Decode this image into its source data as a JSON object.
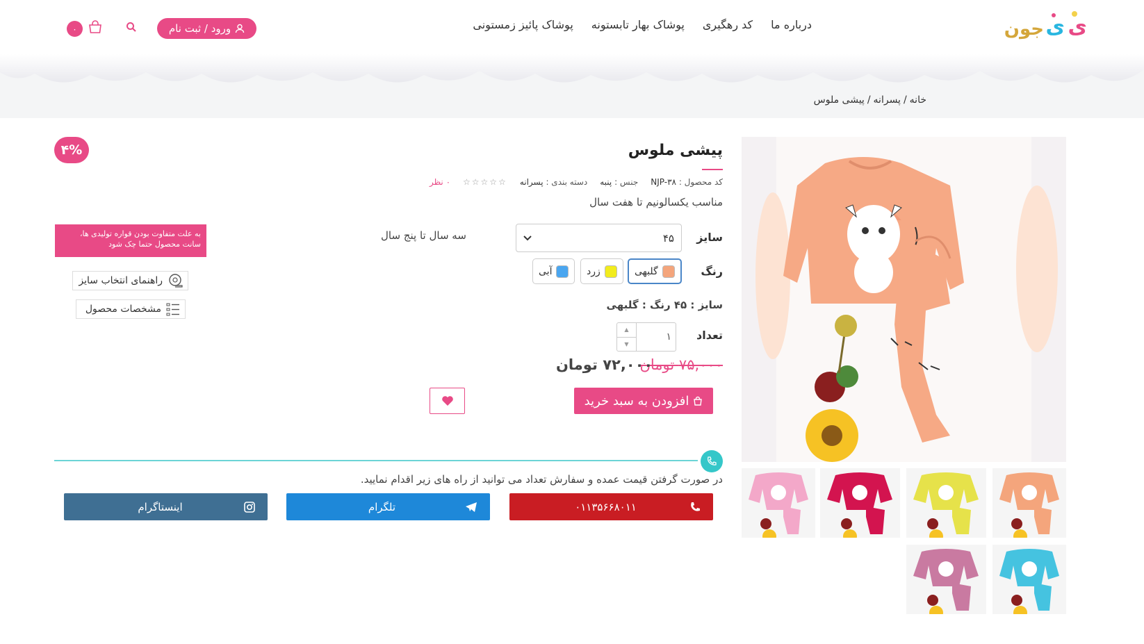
{
  "header": {
    "logo_alt": "نی‌نی جون",
    "nav": [
      "پوشاک پائیز زمستونی",
      "پوشاک بهار تابستونه",
      "کد رهگیری",
      "درباره ما"
    ],
    "login_label": "ورود / ثبت نام",
    "cart_count": "۰"
  },
  "breadcrumb": {
    "home": "خانه",
    "separator": "/",
    "category": "پسرانه",
    "current": "پیشی ملوس"
  },
  "product": {
    "title": "پیشی ملوس",
    "code_label": "کد محصول :",
    "code": "NJP-۳۸",
    "gender_label": "جنس :",
    "gender": "پنبه",
    "category_label": "دسته بندی :",
    "category": "پسرانه",
    "stars": "☆☆☆☆☆",
    "reviews": "۰ نظر",
    "subtitle": "مناسب یکسالونیم تا هفت سال",
    "size_label": "سایز",
    "size_value": "۴۵",
    "size_age": "سه سال تا پنج سال",
    "color_label": "رنگ",
    "colors": [
      {
        "name": "گلبهی",
        "hex": "#f4a57c"
      },
      {
        "name": "زرد",
        "hex": "#f2ec1d"
      },
      {
        "name": "آبی",
        "hex": "#4aa6f0"
      }
    ],
    "selection_summary": "سایز : ۴۵ رنگ : گلبهی",
    "qty_label": "تعداد",
    "qty": "۱",
    "price_old": "۷۵,۰۰۰ تومان",
    "price_new": "۷۲,۰۰۰ تومان",
    "add_to_cart": "افزودن به سبد خرید",
    "discount": "۴%"
  },
  "side": {
    "notice": "به علت متفاوت بودن قواره تولیدی ها، سانت محصول حتما چک شود",
    "size_guide": "راهنمای انتخاب سایز",
    "specs": "مشخصات محصول"
  },
  "contact": {
    "wholesale_text": "در صورت گرفتن قیمت عمده و سفارش تعداد می توانید از راه های زیر اقدام نمایید.",
    "phone": "۰۱۱۳۵۶۶۸۰۱۱",
    "telegram": "تلگرام",
    "instagram": "اینستاگرام"
  },
  "colors": {
    "accent": "#e84a86",
    "teal": "#35c7c9",
    "phone_btn": "#c91d23",
    "telegram_btn": "#1e88d9",
    "instagram_btn": "#3f6f93"
  },
  "thumbnails": [
    {
      "name": "peach",
      "hex": "#f4a57c"
    },
    {
      "name": "yellow",
      "hex": "#e6e24a"
    },
    {
      "name": "red",
      "hex": "#d3144f"
    },
    {
      "name": "pink",
      "hex": "#f3a8c9"
    },
    {
      "name": "cyan",
      "hex": "#45c3e0"
    },
    {
      "name": "mauve",
      "hex": "#c97aa1"
    }
  ]
}
